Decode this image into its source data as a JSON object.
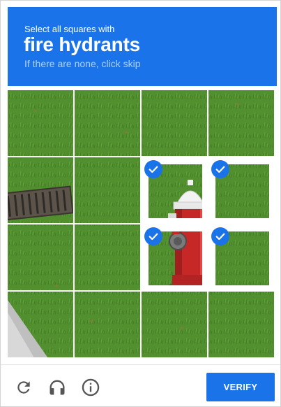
{
  "header": {
    "instruction": "Select all squares with",
    "target": "fire hydrants",
    "hint": "If there are none, click skip"
  },
  "grid": {
    "tiles": [
      {
        "row": 0,
        "col": 0,
        "selected": false
      },
      {
        "row": 0,
        "col": 1,
        "selected": false
      },
      {
        "row": 0,
        "col": 2,
        "selected": false
      },
      {
        "row": 0,
        "col": 3,
        "selected": false
      },
      {
        "row": 1,
        "col": 0,
        "selected": false
      },
      {
        "row": 1,
        "col": 1,
        "selected": false
      },
      {
        "row": 1,
        "col": 2,
        "selected": true
      },
      {
        "row": 1,
        "col": 3,
        "selected": true
      },
      {
        "row": 2,
        "col": 0,
        "selected": false
      },
      {
        "row": 2,
        "col": 1,
        "selected": false
      },
      {
        "row": 2,
        "col": 2,
        "selected": true
      },
      {
        "row": 2,
        "col": 3,
        "selected": true
      },
      {
        "row": 3,
        "col": 0,
        "selected": false
      },
      {
        "row": 3,
        "col": 1,
        "selected": false
      },
      {
        "row": 3,
        "col": 2,
        "selected": false
      },
      {
        "row": 3,
        "col": 3,
        "selected": false
      }
    ]
  },
  "footer": {
    "icons": [
      "reload-icon",
      "audio-headphones-icon",
      "info-icon"
    ],
    "verify_label": "VERIFY"
  },
  "colors": {
    "accent": "#1a73e8",
    "hint": "#aed0fb",
    "grass": "#4a8a2c",
    "hydrant_red": "#c62828"
  }
}
